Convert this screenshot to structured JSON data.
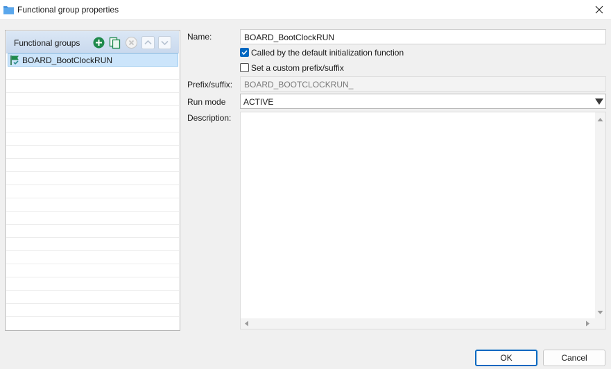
{
  "window": {
    "title": "Functional group properties"
  },
  "left": {
    "header_label": "Functional groups",
    "items": [
      {
        "label": "BOARD_BootClockRUN"
      }
    ]
  },
  "form": {
    "name_label": "Name:",
    "name_value": "BOARD_BootClockRUN",
    "called_by_default_label": "Called by the default initialization function",
    "called_by_default_checked": true,
    "custom_prefix_label": "Set a custom prefix/suffix",
    "custom_prefix_checked": false,
    "prefix_label": "Prefix/suffix:",
    "prefix_value": "BOARD_BOOTCLOCKRUN_",
    "run_mode_label": "Run mode",
    "run_mode_value": "ACTIVE",
    "description_label": "Description:",
    "description_value": ""
  },
  "buttons": {
    "ok": "OK",
    "cancel": "Cancel"
  },
  "colors": {
    "accent": "#0067c0",
    "selection": "#cce5fb",
    "header_gradient_top": "#dbe7f5"
  }
}
